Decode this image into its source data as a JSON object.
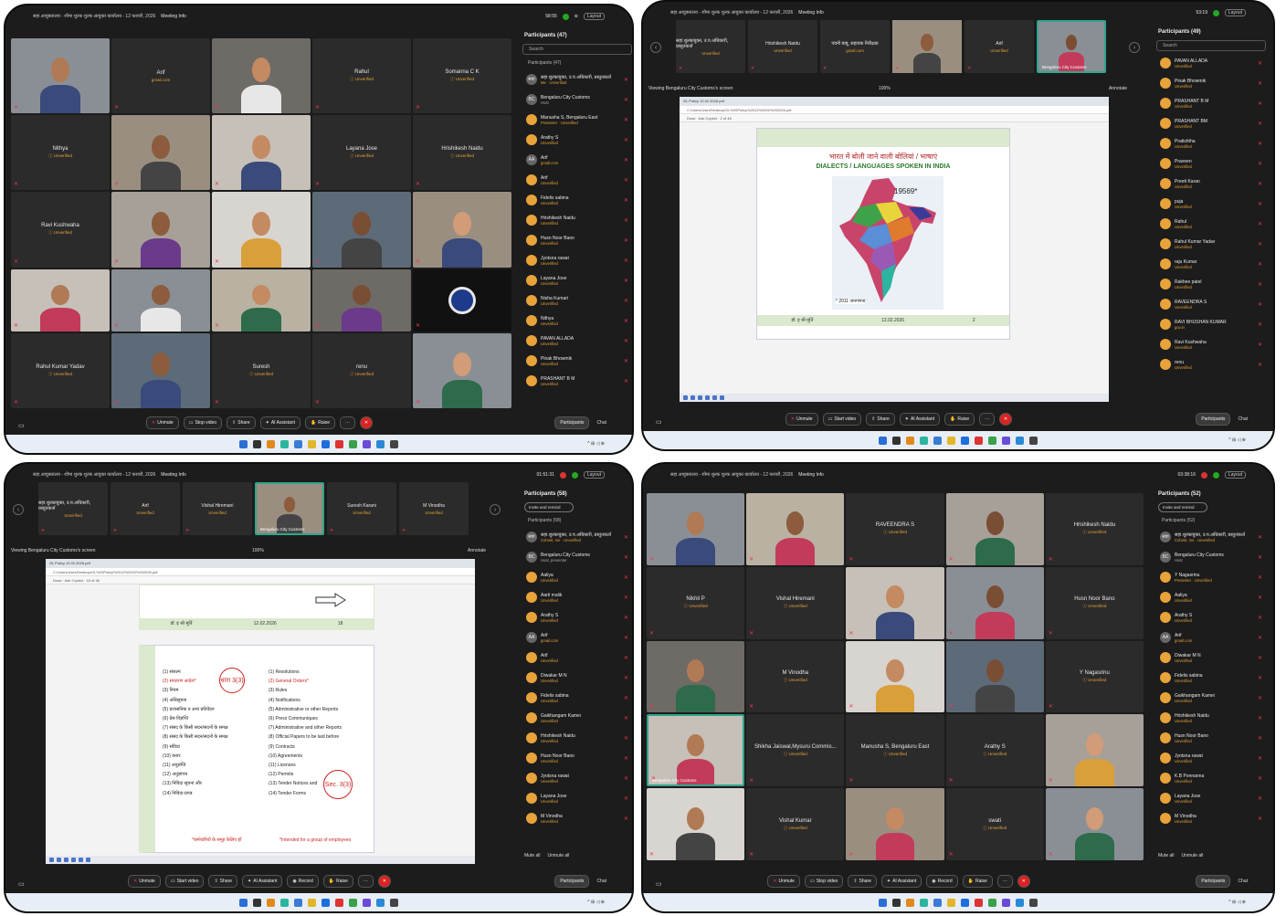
{
  "p1": {
    "title": "सहा.आयुक्तालय - शीमा शुल्क शुल्क आयुक्त कार्यालय - 12 फरवरी, 2026",
    "meeting_info": "Meeting Info",
    "clock": "58:55",
    "layout": "Layout",
    "tiles": [
      {
        "v": 1
      },
      {
        "name": "Arif",
        "status": "gmail.com"
      },
      {
        "v": 1
      },
      {
        "name": "Rahul",
        "status": "Unverified"
      },
      {
        "name": "Somanna C K",
        "status": "Unverified"
      },
      {
        "name": "Nithya",
        "status": "Unverified"
      },
      {
        "v": 1
      },
      {
        "v": 1
      },
      {
        "name": "Layana Jose",
        "status": "Unverified"
      },
      {
        "name": "Hrishikesh Naidu",
        "status": "Unverified"
      },
      {
        "name": "Ravi Kushwaha",
        "status": "Unverified"
      },
      {
        "v": 1
      },
      {
        "v": 1
      },
      {
        "v": 1
      },
      {
        "v": 1
      },
      {
        "v": 1
      },
      {
        "v": 1
      },
      {
        "v": 1
      },
      {
        "v": 1
      },
      {
        "v": 2
      },
      {
        "name": "Rahul Kumar Yadav",
        "status": "Unverified"
      },
      {
        "v": 1
      },
      {
        "name": "Suresh",
        "status": "Unverified"
      },
      {
        "name": "renu",
        "status": "Unverified"
      },
      {
        "v": 1
      }
    ],
    "side": {
      "header": "Participants (47)",
      "search": "Search",
      "section": "Participants (47)",
      "people": [
        {
          "i": "सवा",
          "n": "सहा.शुल्कायुक्त, उ.प.अधिकारी, प्रस्तुतकर्ता",
          "s": "Me · Unverified",
          "g": true
        },
        {
          "i": "BC",
          "n": "Bengaluru City Customs",
          "s": "Host",
          "g": true,
          "w": true
        },
        {
          "i": "",
          "n": "Manusha S, Bengaluru East",
          "s": "Presenter · Unverified"
        },
        {
          "i": "",
          "n": "Arathy S",
          "s": "Unverified"
        },
        {
          "i": "AA",
          "n": "Arif",
          "s": "gmail.com",
          "g": true
        },
        {
          "i": "",
          "n": "Arif",
          "s": "Unverified"
        },
        {
          "i": "",
          "n": "Fidelis sabina",
          "s": "Unverified"
        },
        {
          "i": "",
          "n": "Hrishikesh Naidu",
          "s": "Unverified"
        },
        {
          "i": "",
          "n": "Husn Noor Bano",
          "s": "Unverified"
        },
        {
          "i": "",
          "n": "Jyotsna rawat",
          "s": "Unverified"
        },
        {
          "i": "",
          "n": "Layana Jose",
          "s": "Unverified"
        },
        {
          "i": "",
          "n": "Nisha Kumari",
          "s": "Unverified"
        },
        {
          "i": "",
          "n": "Nithya",
          "s": "Unverified"
        },
        {
          "i": "",
          "n": "PAVAN ALLADA",
          "s": "Unverified"
        },
        {
          "i": "",
          "n": "Pinak Bhowmik",
          "s": "Unverified"
        },
        {
          "i": "",
          "n": "PRASHANT B M",
          "s": "Unverified"
        }
      ]
    },
    "bar": [
      "Unmute",
      "Stop video",
      "Share",
      "AI Assistant",
      "Raise"
    ],
    "right": [
      "Participants",
      "Chat"
    ]
  },
  "p2": {
    "title": "सहा.आयुक्तालय - शीमा शुल्क शुल्क आयुक्त कार्यालय - 12 फरवरी, 2026",
    "meeting_info": "Meeting Info",
    "clock": "53:19",
    "layout": "Layout",
    "strip": [
      {
        "n": "सहा.शुल्कायुक्त, उ.प.अधिकारी, प्रस्तुतकर्ता",
        "s": "Unverified"
      },
      {
        "n": "Hrishikesh Naidu",
        "s": "Unverified"
      },
      {
        "n": "पवनी बाबू, सहायक निरीक्षक",
        "s": "gmail.com"
      },
      {
        "n": "",
        "s": "",
        "v": 1
      },
      {
        "n": "Arif",
        "s": "Unverified"
      },
      {
        "n": "",
        "s": "Bengaluru City Customs",
        "act": true
      }
    ],
    "viewing": "Viewing Bengaluru City Customs's screen",
    "zoom": "100%",
    "annotate": "Annotate",
    "slide": {
      "hindi": "भारत में बोली जाने वाली बोलियां / भाषाएं",
      "english": "DIALECTS / LANGUAGES SPOKEN IN INDIA",
      "count": "19569*",
      "census": "* 2011 जनगणना",
      "footer_left": "डॉ. इ श्री मूर्ति",
      "footer_date": "12.02.2026",
      "footer_page": "2"
    },
    "side": {
      "header": "Participants (49)",
      "search": "Search",
      "people": [
        {
          "n": "PAVAN ALLADA",
          "s": "Unverified"
        },
        {
          "n": "Pinak Bhowmik",
          "s": "Unverified"
        },
        {
          "n": "PRASHANT B M",
          "s": "Unverified"
        },
        {
          "n": "PRASHANT BM",
          "s": "Unverified"
        },
        {
          "n": "Pratishtha",
          "s": "Unverified"
        },
        {
          "n": "Praveen",
          "s": "Unverified"
        },
        {
          "n": "Preeti Karan",
          "s": "Unverified"
        },
        {
          "n": "puja",
          "s": "Unverified"
        },
        {
          "n": "Rahul",
          "s": "Unverified"
        },
        {
          "n": "Rahul Kumar Yadav",
          "s": "Unverified"
        },
        {
          "n": "raju Kumar",
          "s": "Unverified"
        },
        {
          "n": "Rakhee patel",
          "s": "Unverified"
        },
        {
          "n": "RAVEENDRA S",
          "s": "Unverified"
        },
        {
          "n": "RAVI BHUSHAN KUMAR",
          "s": "gov.in"
        },
        {
          "n": "Ravi Kushwaha",
          "s": "Unverified"
        },
        {
          "n": "renu",
          "s": "Unverified"
        }
      ]
    },
    "bar": [
      "Unmute",
      "Start video",
      "Share",
      "AI Assistant",
      "Raise"
    ],
    "right": [
      "Participants",
      "Chat"
    ]
  },
  "p3": {
    "title": "सहा.आयुक्तालय - शीमा शुल्क शुल्क आयुक्त कार्यालय - 12 फरवरी, 2026",
    "meeting_info": "Meeting Info",
    "clock": "01:51:31",
    "layout": "Layout",
    "strip": [
      {
        "n": "सहा.शुल्कायुक्त, उ.प.अधिकारी, प्रस्तुतकर्ता",
        "s": "Unverified"
      },
      {
        "n": "Arif",
        "s": "Unverified"
      },
      {
        "n": "Vishal Hiremani",
        "s": "Unverified"
      },
      {
        "n": "",
        "s": "Bengaluru City Customs",
        "act": true
      },
      {
        "n": "Suresh Karani",
        "s": "Unverified"
      },
      {
        "n": "M Vinodha",
        "s": "Unverified"
      }
    ],
    "viewing": "Viewing Bengaluru City Customs's screen",
    "zoom": "100%",
    "annotate": "Annotate",
    "slide": {
      "footer_left": "डॉ. इ श्री मूर्ति",
      "footer_date": "12.02.2026",
      "footer_page": "18",
      "hindi": [
        "(1) संकल्प",
        "(2) साधारण आदेश*",
        "(3) नियम",
        "(4) अधिसूचना",
        "(5) प्रशासनिक व अन्य प्रतिवेदन",
        "(6) प्रेस विज्ञप्ति",
        "(7) संसद के किसी सदन/सदनों के समक्ष",
        "(8) संसद के किसी सदन/सदनों के समक्ष",
        "(9) संविदा",
        "(10) करार",
        "(11) अनुज्ञप्ति",
        "(12) अनुज्ञापत्र",
        "(13) निविदा सूचना और",
        "(14) निविदा-प्रपत्र"
      ],
      "english": [
        "(1) Resolutions",
        "(2) General Orders*",
        "(3) Rules",
        "(4) Notifications",
        "(5) Administrative or other Reports",
        "(6) Press Communiques",
        "(7) Administrative and other Reports",
        "(8) Official Papers to be laid before",
        "(9) Contracts",
        "(10) Agreements",
        "(11) Licenses",
        "(12) Permits",
        "(13) Tender Notices and",
        "(14) Tender Forms"
      ],
      "dhara": "धारा 3(3)",
      "sec": "Sec. 3(3)",
      "note_hi": "*कर्मचारियों के समूह केलिए हों",
      "note_en": "*Intended for a group of employees"
    },
    "side": {
      "header": "Participants (58)",
      "invite": "Invite and remind",
      "section": "Participants (58)",
      "people": [
        {
          "i": "सवा",
          "n": "सहा.शुल्कायुक्त, उ.प.अधिकारी, प्रस्तुतकर्ता",
          "s": "Cohost, me · Unverified",
          "g": true
        },
        {
          "i": "BC",
          "n": "Bengaluru City Customs",
          "s": "Host, presenter",
          "g": true,
          "w": true
        },
        {
          "i": "",
          "n": "Aaliya",
          "s": "Unverified"
        },
        {
          "i": "",
          "n": "Aarti malik",
          "s": "Unverified"
        },
        {
          "i": "",
          "n": "Arathy S",
          "s": "Unverified"
        },
        {
          "i": "AA",
          "n": "Arif",
          "s": "gmail.com",
          "g": true
        },
        {
          "i": "",
          "n": "Arif",
          "s": "Unverified"
        },
        {
          "i": "",
          "n": "Diwakar M N",
          "s": "Unverified"
        },
        {
          "i": "",
          "n": "Fidelis sabina",
          "s": "Unverified"
        },
        {
          "i": "",
          "n": "Gaikhangam Kamei",
          "s": "Unverified"
        },
        {
          "i": "",
          "n": "Hrishikesh Naidu",
          "s": "Unverified"
        },
        {
          "i": "",
          "n": "Husn Noor Bano",
          "s": "Unverified"
        },
        {
          "i": "",
          "n": "Jyotsna rawat",
          "s": "Unverified"
        },
        {
          "i": "",
          "n": "Layana Jose",
          "s": "Unverified"
        },
        {
          "i": "",
          "n": "M Vinodha",
          "s": "Unverified"
        }
      ],
      "mute_all": "Mute all",
      "unmute_all": "Unmute all"
    },
    "bar": [
      "Unmute",
      "Start video",
      "Share",
      "AI Assistant",
      "Record",
      "Raise"
    ],
    "right": [
      "Participants",
      "Chat"
    ]
  },
  "p4": {
    "title": "सहा.आयुक्तालय - शीमा शुल्क शुल्क आयुक्त कार्यालय - 12 फरवरी, 2026",
    "meeting_info": "Meeting Info",
    "clock": "03:38:16",
    "layout": "Layout",
    "tiles": [
      {
        "v": 1
      },
      {
        "v": 1
      },
      {
        "name": "RAVEENDRA S",
        "status": "Unverified"
      },
      {
        "v": 1
      },
      {
        "name": "Hrishikesh Naidu",
        "status": "Unverified"
      },
      {
        "name": "Nikhil P",
        "status": "Unverified"
      },
      {
        "name": "Vishal Hiremani",
        "status": "Unverified"
      },
      {
        "v": 1
      },
      {
        "v": 1
      },
      {
        "name": "Husn Noor Bano",
        "status": "Unverified"
      },
      {
        "v": 1
      },
      {
        "name": "M Vinodha",
        "status": "Unverified"
      },
      {
        "v": 1
      },
      {
        "v": 1
      },
      {
        "name": "Y Nagasrinu",
        "status": "Unverified"
      },
      {
        "v": 1,
        "cap": "Bengaluru City Customs",
        "act": true
      },
      {
        "name": "Shikha Jaiswal,Mysuru Commis...",
        "status": "Unverified"
      },
      {
        "name": "Manusha S, Bengaluru East",
        "status": "Unverified"
      },
      {
        "name": "Arathy S",
        "status": "Unverified"
      },
      {
        "v": 1
      },
      {
        "v": 1
      },
      {
        "name": "Vishal Kumar",
        "status": "Unverified"
      },
      {
        "v": 1
      },
      {
        "name": "swati",
        "status": "Unverified"
      },
      {
        "v": 1
      }
    ],
    "side": {
      "header": "Participants (52)",
      "invite": "Invite and remind",
      "section": "Participants (52)",
      "people": [
        {
          "i": "सवा",
          "n": "सहा.शुल्कायुक्त, उ.प.अधिकारी, प्रस्तुतकर्ता",
          "s": "Cohost, me · Unverified",
          "g": true
        },
        {
          "i": "BC",
          "n": "Bengaluru City Customs",
          "s": "Host",
          "g": true,
          "w": true
        },
        {
          "i": "",
          "n": "Y Nagasrinu",
          "s": "Presenter · Unverified"
        },
        {
          "i": "",
          "n": "Aaliya",
          "s": "Unverified"
        },
        {
          "i": "",
          "n": "Arathy S",
          "s": "Unverified"
        },
        {
          "i": "AA",
          "n": "Arif",
          "s": "gmail.com",
          "g": true
        },
        {
          "i": "",
          "n": "Diwakar M N",
          "s": "Unverified"
        },
        {
          "i": "",
          "n": "Fidelis sabina",
          "s": "Unverified"
        },
        {
          "i": "",
          "n": "Gaikhangam Kamei",
          "s": "Unverified"
        },
        {
          "i": "",
          "n": "Hrishikesh Naidu",
          "s": "Unverified"
        },
        {
          "i": "",
          "n": "Husn Noor Bano",
          "s": "Unverified"
        },
        {
          "i": "",
          "n": "Jyotsna rawat",
          "s": "Unverified"
        },
        {
          "i": "",
          "n": "K.B Ponnanna",
          "s": "Unverified"
        },
        {
          "i": "",
          "n": "Layana Jose",
          "s": "Unverified"
        },
        {
          "i": "",
          "n": "M Vinodha",
          "s": "Unverified"
        }
      ],
      "mute_all": "Mute all",
      "unmute_all": "Unmute all"
    },
    "bar": [
      "Unmute",
      "Stop video",
      "Share",
      "AI Assistant",
      "Record",
      "Raise"
    ],
    "right": [
      "Participants",
      "Chat"
    ]
  },
  "colors": {
    "unverified": "#e8a33a",
    "leave": "#dd2222",
    "active": "#2fa58c"
  }
}
